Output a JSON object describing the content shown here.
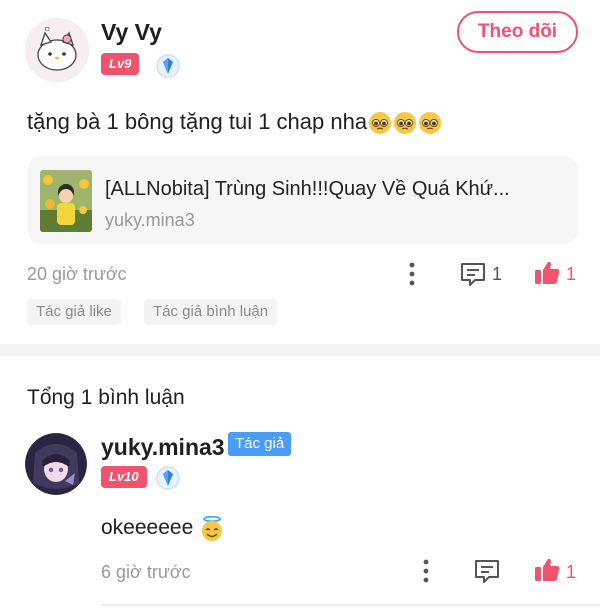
{
  "post": {
    "author_name": "Vy Vy",
    "author_level": "Lv9",
    "follow_label": "Theo dõi",
    "text": "tặng bà 1 bông tặng tui 1 chap nha",
    "text_emojis": [
      "pleading-face",
      "pleading-face",
      "pleading-face"
    ],
    "linked": {
      "title": "[ALLNobita] Trùng Sinh!!!Quay Về Quá Khứ...",
      "author": "yuky.mina3"
    },
    "time": "20 giờ trước",
    "comment_count": "1",
    "like_count": "1",
    "tags": [
      "Tác giả like",
      "Tác giả bình luận"
    ]
  },
  "comments": {
    "total_label": "Tổng 1 bình luận",
    "items": [
      {
        "author_name": "yuky.mina3",
        "author_badge": "Tác giả",
        "author_level": "Lv10",
        "text": "okeeeeee",
        "emoji": "smiling-face-with-halo",
        "time": "6 giờ trước",
        "like_count": "1"
      }
    ]
  },
  "colors": {
    "accent": "#f0536d",
    "author_badge": "#4a9df6",
    "muted": "#9a9a9a"
  },
  "icons": [
    "verified-shield-icon",
    "more-vertical-icon",
    "comment-icon",
    "thumbs-up-icon"
  ]
}
